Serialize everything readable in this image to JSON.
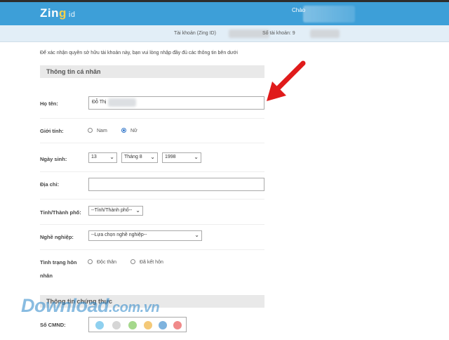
{
  "header": {
    "logo_main": "Zin",
    "logo_g": "g",
    "logo_id": "id",
    "greeting": "Chào"
  },
  "account": {
    "account_label": "Tài khoản (Zing ID)",
    "number_label": "Số tài khoản: 9"
  },
  "form": {
    "intro": "Để xác nhận quyền sở hữu tài khoản này, bạn vui lòng nhập đầy đủ các thông tin bên dưới",
    "section_personal": "Thông tin cá nhân",
    "section_verify": "Thông tin chứng thực",
    "fullname_label": "Họ tên:",
    "fullname_value": "Đỗ Thị",
    "gender_label": "Giới tính:",
    "gender_options": [
      "Nam",
      "Nữ"
    ],
    "gender_selected": "Nữ",
    "birthday_label": "Ngày sinh:",
    "birthday_day": "13",
    "birthday_month": "Tháng 8",
    "birthday_year": "1998",
    "address_label": "Địa chỉ:",
    "address_value": "",
    "province_label": "Tỉnh/Thành phố:",
    "province_value": "--Tỉnh/Thành phố--",
    "job_label": "Nghề nghiệp:",
    "job_value": "--Lựa chọn nghề nghiệp--",
    "marital_label_line1": "Tình trạng hôn",
    "marital_label_line2": "nhân",
    "marital_options": [
      "Độc thân",
      "Đã kết hôn"
    ],
    "id_label": "Số CMND:"
  },
  "watermark": {
    "main": "Download",
    "domain": ".com.vn"
  },
  "colors": {
    "topbar": "#3d9fd8",
    "arrow": "#e01b1b",
    "radio_selected": "#2e73c8"
  }
}
